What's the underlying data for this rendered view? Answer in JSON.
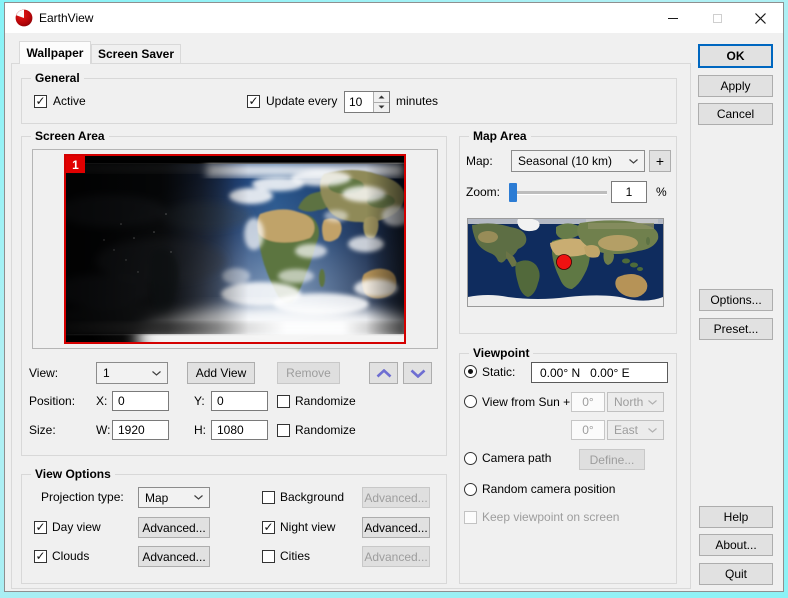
{
  "window": {
    "title": "EarthView"
  },
  "tabs": {
    "wallpaper": "Wallpaper",
    "screensaver": "Screen Saver"
  },
  "buttons": {
    "ok": "OK",
    "apply": "Apply",
    "cancel": "Cancel",
    "options": "Options...",
    "preset": "Preset...",
    "help": "Help",
    "about": "About...",
    "quit": "Quit"
  },
  "general": {
    "title": "General",
    "active": "Active",
    "update_every": "Update every",
    "interval": "10",
    "unit": "minutes"
  },
  "screen_area": {
    "title": "Screen Area",
    "view_badge": "1",
    "view_label": "View:",
    "view_value": "1",
    "add_view": "Add View",
    "remove": "Remove",
    "position": "Position:",
    "x": "X:",
    "x_value": "0",
    "y": "Y:",
    "y_value": "0",
    "size": "Size:",
    "w": "W:",
    "w_value": "1920",
    "h": "H:",
    "h_value": "1080",
    "randomize": "Randomize"
  },
  "view_options": {
    "title": "View Options",
    "projection_label": "Projection type:",
    "projection_value": "Map",
    "background": "Background",
    "day_view": "Day view",
    "night_view": "Night view",
    "clouds": "Clouds",
    "cities": "Cities",
    "advanced": "Advanced..."
  },
  "map_area": {
    "title": "Map Area",
    "map_label": "Map:",
    "map_value": "Seasonal (10 km)",
    "add_map": "+",
    "zoom_label": "Zoom:",
    "zoom_value": "1",
    "zoom_unit": "%"
  },
  "viewpoint": {
    "title": "Viewpoint",
    "static_label": "Static:",
    "static_value": "0.00° N   0.00° E",
    "sun_label": "View from Sun +",
    "lat_value": "0°",
    "lat_dir": "North",
    "lon_value": "0°",
    "lon_dir": "East",
    "camera_path": "Camera path",
    "define": "Define...",
    "random": "Random camera position",
    "keep_on_screen": "Keep viewpoint on screen"
  },
  "icons": {
    "check": "✓"
  },
  "colors": {
    "accent_blue": "#0067c0",
    "slider_blue": "#2c7cd4",
    "selection_red": "#d40000",
    "badge_red": "#e10000",
    "marker_red": "#ee1111",
    "desktop_cyan": "#a6eef3",
    "dialog_bg": "#f0f0f0",
    "titlebar_bg": "#ffffff"
  }
}
